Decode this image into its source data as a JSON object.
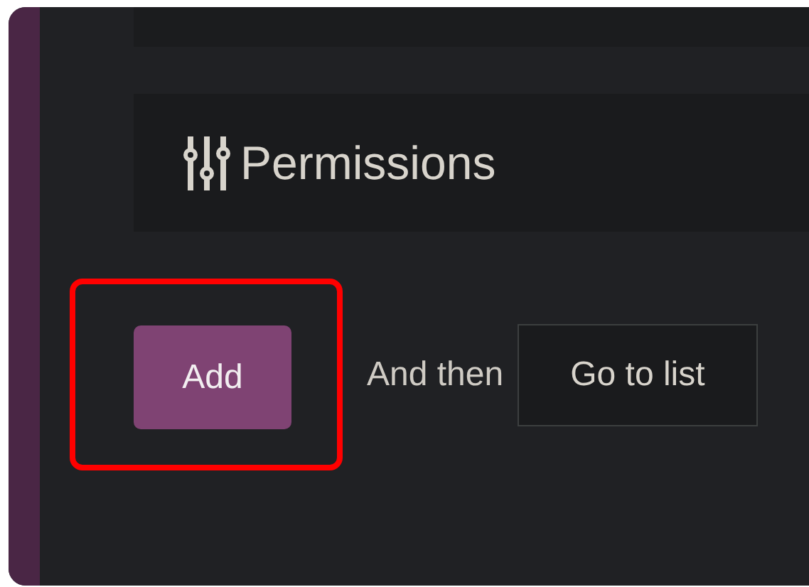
{
  "section": {
    "title": "Permissions"
  },
  "actions": {
    "add_button": "Add",
    "highlighted": true,
    "then_label": "And then",
    "then_select": "Go to list"
  }
}
